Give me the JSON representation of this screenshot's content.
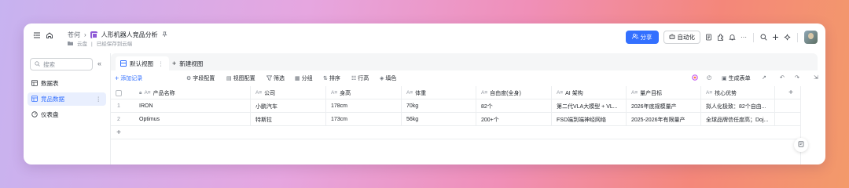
{
  "breadcrumb": {
    "owner": "苍何",
    "title": "人形机器人竞品分析",
    "location": "云盘",
    "save_status": "已经保存到云端"
  },
  "header": {
    "share_label": "分享",
    "automation_label": "自动化",
    "more": "···"
  },
  "sidebar": {
    "search_placeholder": "搜索",
    "collapse": "«",
    "items": [
      {
        "label": "数据表",
        "active": false
      },
      {
        "label": "竞品数据",
        "active": true
      },
      {
        "label": "仪表盘",
        "active": false
      }
    ],
    "more": "⋮"
  },
  "view_tabs": {
    "default_view": "默认视图",
    "default_more": "⋮",
    "new_view": "新建视图"
  },
  "toolbar": {
    "add_record": "添加记录",
    "field_config": "字段配置",
    "view_config": "视图配置",
    "filter": "筛选",
    "group": "分组",
    "sort": "排序",
    "row_height": "行高",
    "fill_color": "填色",
    "generate_form": "生成表单"
  },
  "table": {
    "columns": [
      "产品名称",
      "公司",
      "身高",
      "体重",
      "自由度(全身)",
      "AI 架构",
      "量产目标",
      "核心优势"
    ],
    "rows": [
      {
        "index": "1",
        "cells": [
          "IRON",
          "小鹏汽车",
          "178cm",
          "70kg",
          "82个",
          "第二代VLA大模型 + VL...",
          "2026年底规模量产",
          "拟人化极致：82个自由..."
        ]
      },
      {
        "index": "2",
        "cells": [
          "Optimus",
          "特斯拉",
          "173cm",
          "56kg",
          "200+个",
          "FSD端到端神经网络",
          "2025-2026年有限量产",
          "全球品牌信任度高；Doj..."
        ]
      }
    ],
    "add_row": "+",
    "add_column": "+"
  },
  "colors": {
    "accent": "#3370ff",
    "bitable_logo": "#8f5ad6"
  }
}
